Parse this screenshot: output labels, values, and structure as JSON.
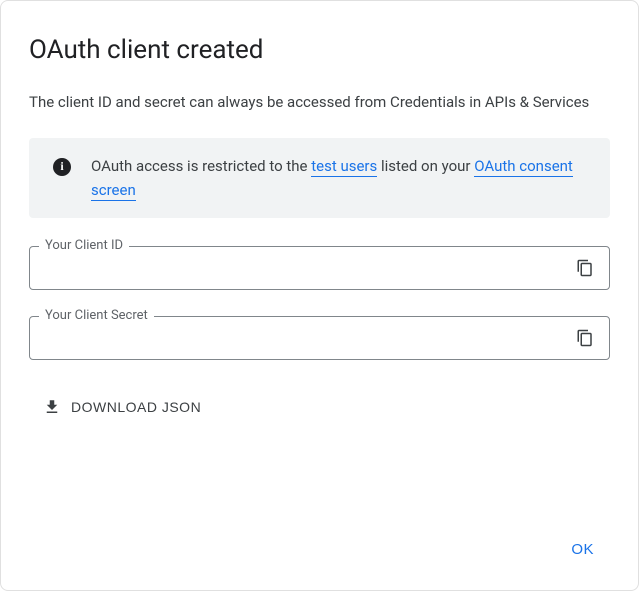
{
  "title": "OAuth client created",
  "description": "The client ID and secret can always be accessed from Credentials in APIs & Services",
  "banner": {
    "prefix": "OAuth access is restricted to the ",
    "link1": "test users",
    "mid": " listed on your ",
    "link2": "OAuth consent screen"
  },
  "fields": {
    "client_id": {
      "label": "Your Client ID",
      "value": ""
    },
    "client_secret": {
      "label": "Your Client Secret",
      "value": ""
    }
  },
  "download_label": "DOWNLOAD JSON",
  "ok_label": "OK"
}
